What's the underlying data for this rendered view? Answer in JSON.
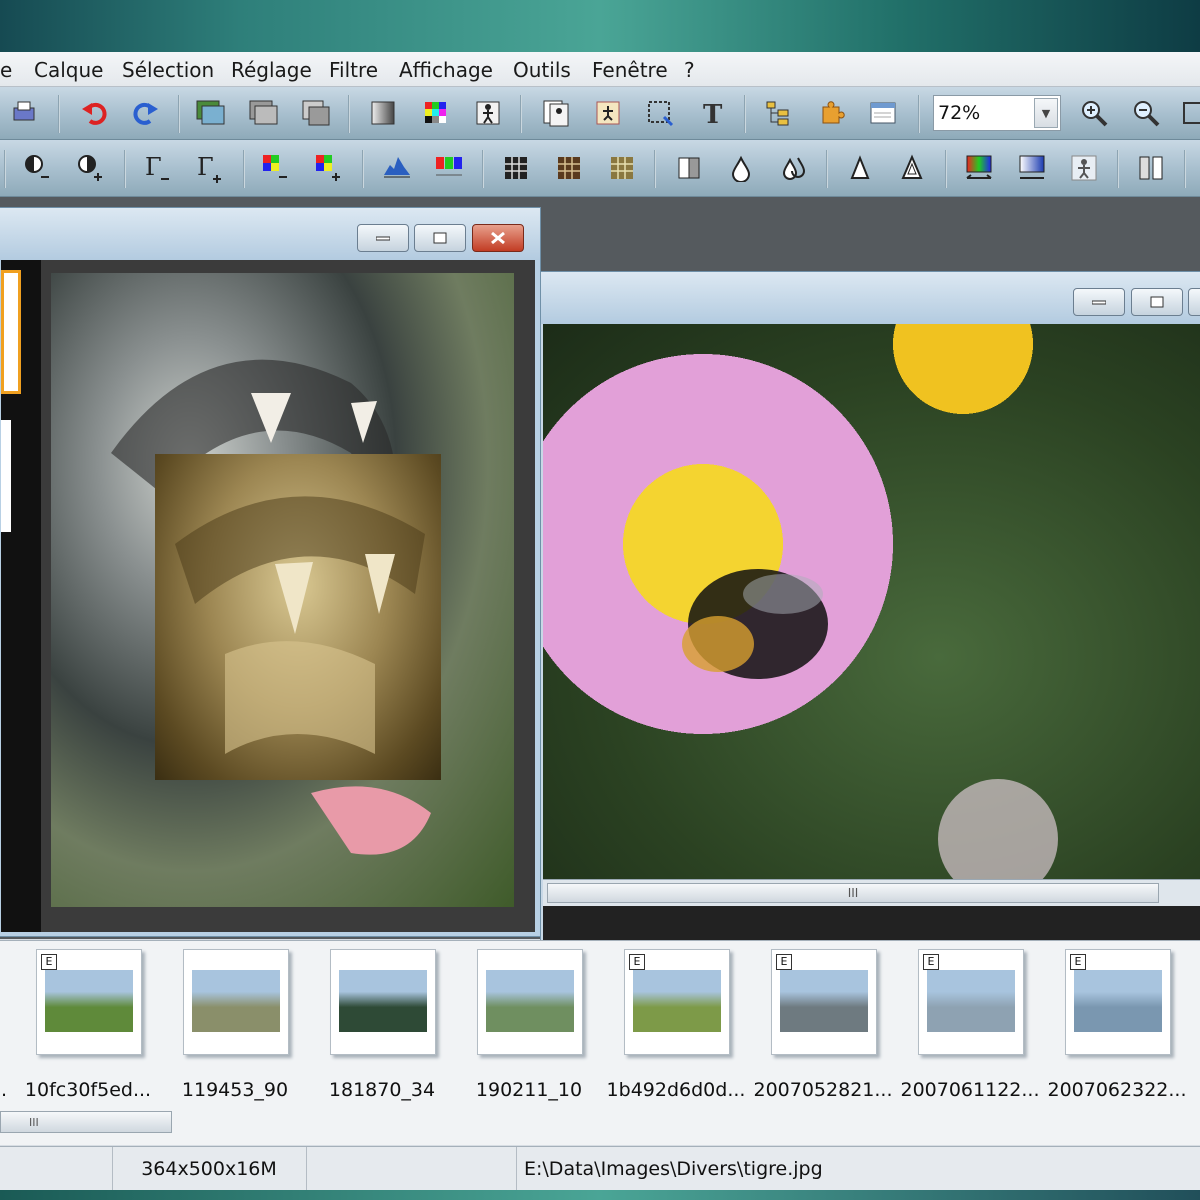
{
  "menu": {
    "items": [
      "e",
      "Calque",
      "Sélection",
      "Réglage",
      "Filtre",
      "Affichage",
      "Outils",
      "Fenêtre",
      "?"
    ]
  },
  "toolbar": {
    "zoom_value": "72%"
  },
  "icons": {
    "toolbar1": [
      "print-icon",
      "undo-icon",
      "redo-icon",
      "image-icon",
      "image-gray-icon",
      "image-copy-icon",
      "gradient-icon",
      "color-palette-icon",
      "walker-icon",
      "contact-sheet-icon",
      "slideshow-icon",
      "selection-icon",
      "text-icon",
      "tree-icon",
      "puzzle-icon",
      "window-icon",
      "zoom-in-icon",
      "zoom-out-icon"
    ],
    "toolbar2": [
      "brightness-minus-icon",
      "brightness-plus-icon",
      "gamma-minus-icon",
      "gamma-plus-icon",
      "color-minus-icon",
      "color-plus-icon",
      "histogram-icon",
      "levels-icon",
      "grid-dark-icon",
      "grid-brown-icon",
      "grid-tan-icon",
      "contrast-icon",
      "drop-icon",
      "drops-icon",
      "sharpen-icon",
      "sharpen-more-icon",
      "rgb-balance-icon",
      "gradient-map-icon",
      "effect-icon",
      "mirror-icon"
    ]
  },
  "windows": {
    "left_caption": "",
    "right_caption": ""
  },
  "thumbnails": [
    {
      "label": "10fc30f5ed...",
      "badge": "E",
      "color": "#5f8a3a"
    },
    {
      "label": "119453_90",
      "badge": "",
      "color": "#8a8f6a"
    },
    {
      "label": "181870_34",
      "badge": "",
      "color": "#2e4a36"
    },
    {
      "label": "190211_10",
      "badge": "",
      "color": "#6f8f60"
    },
    {
      "label": "1b492d6d0d...",
      "badge": "E",
      "color": "#7d9a48"
    },
    {
      "label": "2007052821...",
      "badge": "E",
      "color": "#6e7a80"
    },
    {
      "label": "2007061122...",
      "badge": "E",
      "color": "#8ea2b2"
    },
    {
      "label": "2007062322...",
      "badge": "E",
      "color": "#7a97b0"
    }
  ],
  "thumb_partial_label": ".",
  "scroll": {
    "h_grip": "III",
    "thumb_grip": "III"
  },
  "status": {
    "dimensions": "364x500x16M",
    "path": "E:\\Data\\Images\\Divers\\tigre.jpg"
  }
}
